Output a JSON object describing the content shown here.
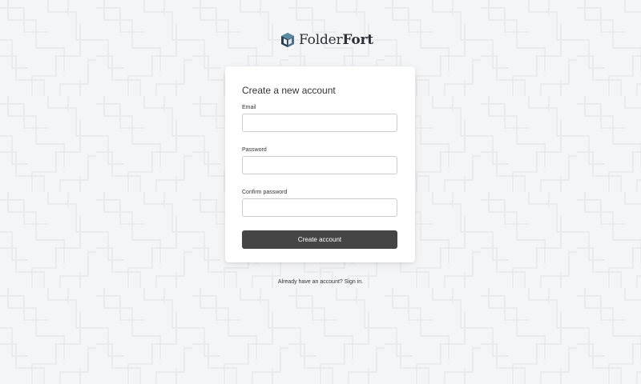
{
  "brand": {
    "name_light": "Folder",
    "name_bold": "Fort",
    "logo_icon": "folder-box-icon"
  },
  "colors": {
    "page_background": "#f4f5f6",
    "card_background": "#ffffff",
    "button_background": "#454545",
    "button_text": "#ffffff",
    "input_border": "#c9cdd2"
  },
  "form": {
    "title": "Create a new account",
    "email": {
      "label": "Email",
      "value": "",
      "placeholder": ""
    },
    "password": {
      "label": "Password",
      "value": "",
      "placeholder": ""
    },
    "confirm_password": {
      "label": "Confirm password",
      "value": "",
      "placeholder": ""
    },
    "submit_label": "Create account"
  },
  "footer": {
    "prompt": "Already have an account?",
    "link": "Sign in."
  }
}
